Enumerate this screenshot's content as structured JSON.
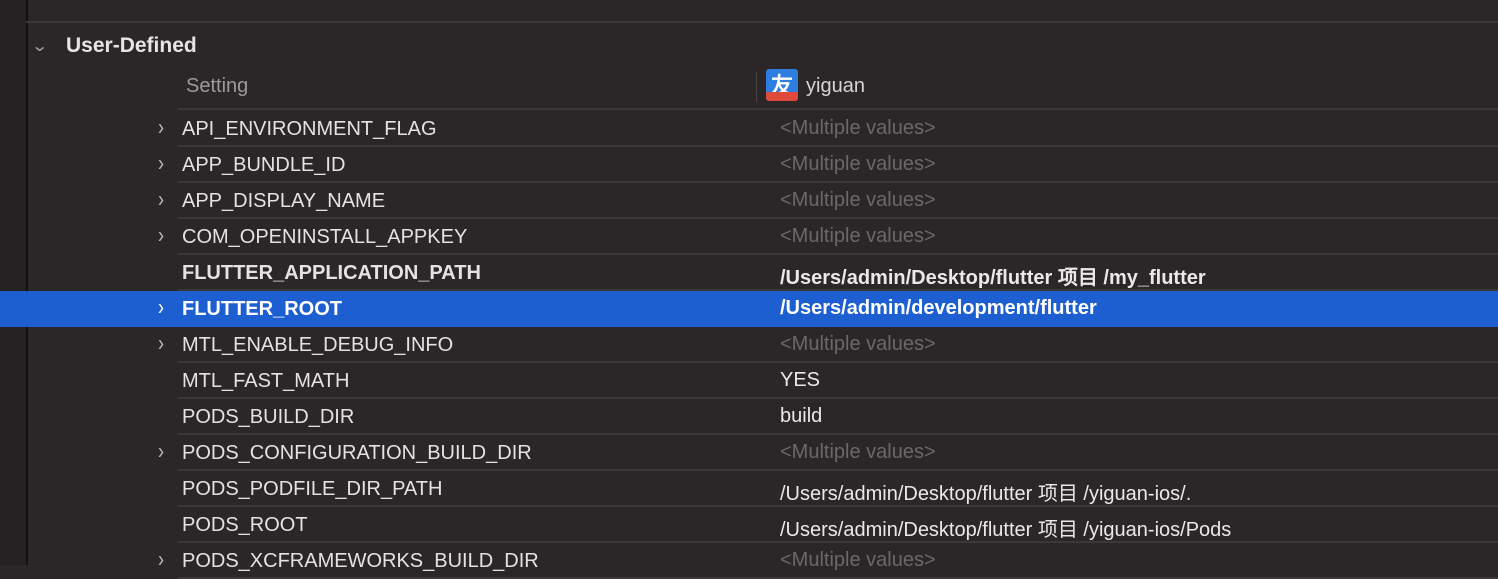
{
  "section": {
    "title": "User-Defined"
  },
  "header": {
    "setting_label": "Setting",
    "target_name": "yiguan",
    "app_icon_glyph": "友"
  },
  "rows": [
    {
      "name": "API_ENVIRONMENT_FLAG",
      "value": "<Multiple values>",
      "expandable": true,
      "multi": true
    },
    {
      "name": "APP_BUNDLE_ID",
      "value": "<Multiple values>",
      "expandable": true,
      "multi": true
    },
    {
      "name": "APP_DISPLAY_NAME",
      "value": "<Multiple values>",
      "expandable": true,
      "multi": true
    },
    {
      "name": "COM_OPENINSTALL_APPKEY",
      "value": "<Multiple values>",
      "expandable": true,
      "multi": true
    },
    {
      "name": "FLUTTER_APPLICATION_PATH",
      "value": "/Users/admin/Desktop/flutter 项目 /my_flutter",
      "expandable": false,
      "bold": true
    },
    {
      "name": "FLUTTER_ROOT",
      "value": "/Users/admin/development/flutter",
      "expandable": true,
      "bold": true,
      "selected": true
    },
    {
      "name": "MTL_ENABLE_DEBUG_INFO",
      "value": "<Multiple values>",
      "expandable": true,
      "multi": true
    },
    {
      "name": "MTL_FAST_MATH",
      "value": "YES",
      "expandable": false
    },
    {
      "name": "PODS_BUILD_DIR",
      "value": "build",
      "expandable": false
    },
    {
      "name": "PODS_CONFIGURATION_BUILD_DIR",
      "value": "<Multiple values>",
      "expandable": true,
      "multi": true
    },
    {
      "name": "PODS_PODFILE_DIR_PATH",
      "value": "/Users/admin/Desktop/flutter 项目 /yiguan-ios/.",
      "expandable": false
    },
    {
      "name": "PODS_ROOT",
      "value": "/Users/admin/Desktop/flutter 项目 /yiguan-ios/Pods",
      "expandable": false
    },
    {
      "name": "PODS_XCFRAMEWORKS_BUILD_DIR",
      "value": "<Multiple values>",
      "expandable": true,
      "multi": true
    }
  ],
  "colors": {
    "selection": "#1d5fd0",
    "background": "#2b2628"
  }
}
